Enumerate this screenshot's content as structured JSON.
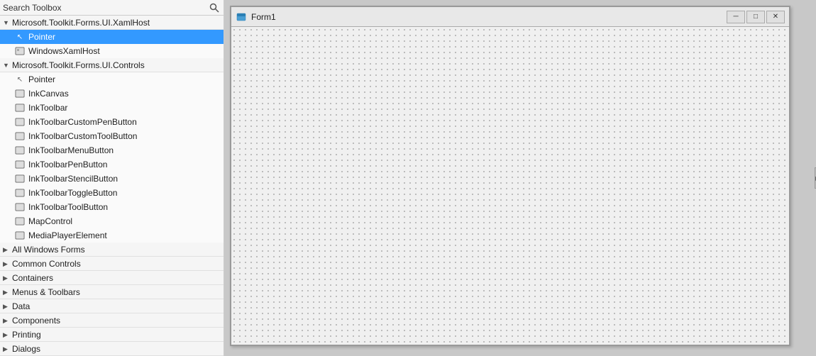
{
  "toolbox": {
    "search_label": "Search Toolbox",
    "search_placeholder": "Search Toolbox",
    "groups": [
      {
        "id": "xamlhost",
        "label": "Microsoft.Toolkit.Forms.UI.XamlHost",
        "expanded": true,
        "items": [
          {
            "id": "pointer1",
            "label": "Pointer",
            "icon": "pointer",
            "selected": true
          },
          {
            "id": "windowsxamlhost",
            "label": "WindowsXamlHost",
            "icon": "component"
          }
        ]
      },
      {
        "id": "controls",
        "label": "Microsoft.Toolkit.Forms.UI.Controls",
        "expanded": true,
        "items": [
          {
            "id": "pointer2",
            "label": "Pointer",
            "icon": "pointer",
            "selected": false
          },
          {
            "id": "inkcanvas",
            "label": "InkCanvas",
            "icon": "component"
          },
          {
            "id": "inktoolbar",
            "label": "InkToolbar",
            "icon": "component"
          },
          {
            "id": "inktoolbarcustompenbutton",
            "label": "InkToolbarCustomPenButton",
            "icon": "component"
          },
          {
            "id": "inktoolbarcustomtoolbutton",
            "label": "InkToolbarCustomToolButton",
            "icon": "component"
          },
          {
            "id": "inktoolbarmenubutton",
            "label": "InkToolbarMenuButton",
            "icon": "component"
          },
          {
            "id": "inktoolbarpenbutton",
            "label": "InkToolbarPenButton",
            "icon": "component"
          },
          {
            "id": "inktoolbarstencilbutton",
            "label": "InkToolbarStencilButton",
            "icon": "component"
          },
          {
            "id": "inktoolbartogglebutton",
            "label": "InkToolbarToggleButton",
            "icon": "component"
          },
          {
            "id": "inktoolbartoolbutton",
            "label": "InkToolbarToolButton",
            "icon": "component"
          },
          {
            "id": "mapcontrol",
            "label": "MapControl",
            "icon": "component"
          },
          {
            "id": "mediaplayerelement",
            "label": "MediaPlayerElement",
            "icon": "component"
          }
        ]
      }
    ],
    "collapsed_groups": [
      {
        "id": "allwindowsforms",
        "label": "All Windows Forms"
      },
      {
        "id": "commoncontrols",
        "label": "Common Controls"
      },
      {
        "id": "containers",
        "label": "Containers"
      },
      {
        "id": "menustoolbars",
        "label": "Menus & Toolbars"
      },
      {
        "id": "data",
        "label": "Data"
      },
      {
        "id": "components",
        "label": "Components"
      },
      {
        "id": "printing",
        "label": "Printing"
      },
      {
        "id": "dialogs",
        "label": "Dialogs"
      }
    ]
  },
  "form": {
    "title": "Form1",
    "buttons": {
      "minimize": "─",
      "maximize": "□",
      "close": "✕"
    }
  }
}
